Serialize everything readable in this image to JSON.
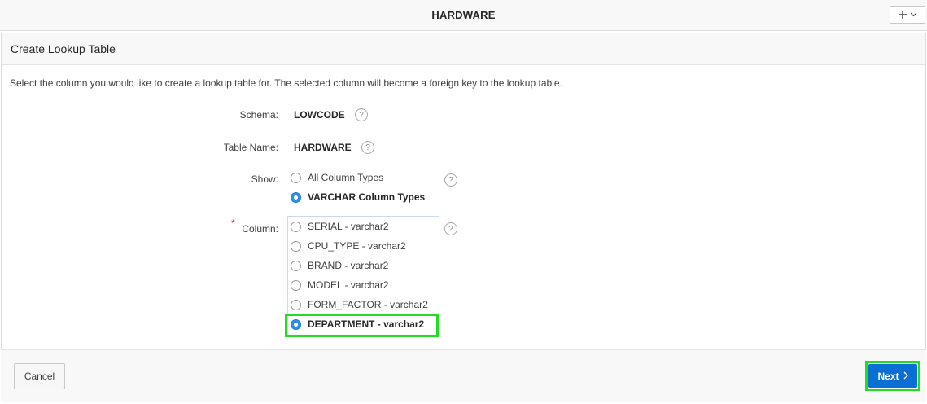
{
  "app": {
    "title": "HARDWARE"
  },
  "region": {
    "title": "Create Lookup Table",
    "instructions": "Select the column you would like to create a lookup table for. The selected column will become a foreign key to the lookup table."
  },
  "form": {
    "schema": {
      "label": "Schema:",
      "value": "LOWCODE"
    },
    "table_name": {
      "label": "Table Name:",
      "value": "HARDWARE"
    },
    "show": {
      "label": "Show:",
      "options": [
        {
          "label": "All Column Types",
          "selected": false
        },
        {
          "label": "VARCHAR Column Types",
          "selected": true
        }
      ]
    },
    "column": {
      "required_marker": "*",
      "label": "Column:",
      "options": [
        {
          "label": "SERIAL - varchar2",
          "selected": false
        },
        {
          "label": "CPU_TYPE - varchar2",
          "selected": false
        },
        {
          "label": "BRAND - varchar2",
          "selected": false
        },
        {
          "label": "MODEL - varchar2",
          "selected": false
        },
        {
          "label": "FORM_FACTOR - varchar2",
          "selected": false
        },
        {
          "label": "DEPARTMENT - varchar2",
          "selected": true
        }
      ]
    },
    "help_glyph": "?"
  },
  "footer": {
    "cancel_label": "Cancel",
    "next_label": "Next"
  },
  "colors": {
    "primary": "#0a6fd3",
    "radio_selected": "#2f8fe8",
    "highlight": "#22dd22",
    "required": "#e03030"
  },
  "icons": {
    "add_menu": "plus-icon",
    "add_menu_caret": "chevron-down-icon",
    "next": "chevron-right-icon",
    "help": "help-icon"
  }
}
